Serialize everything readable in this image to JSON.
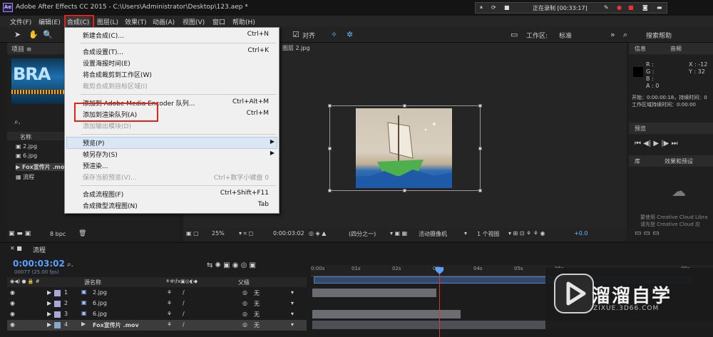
{
  "window": {
    "app_icon": "Ae",
    "title": "Adobe After Effects CC 2015 - C:\\Users\\Administrator\\Desktop\\123.aep *",
    "recording": "正在录制 [00:33:17]"
  },
  "menubar": [
    "文件(F)",
    "编辑(E)",
    "合成(C)",
    "图层(L)",
    "效果(T)",
    "动画(A)",
    "视图(V)",
    "窗口",
    "帮助(H)"
  ],
  "toolbar": {
    "snap_label": "对齐",
    "workspace_label": "工作区:",
    "workspace_value": "标准",
    "search_help": "搜索帮助"
  },
  "composition_menu": {
    "items": [
      {
        "label": "新建合成(C)...",
        "shortcut": "Ctrl+N",
        "disabled": false
      },
      {
        "label": "合成设置(T)...",
        "shortcut": "Ctrl+K",
        "disabled": false
      },
      {
        "label": "设置海报时间(E)",
        "shortcut": "",
        "disabled": false
      },
      {
        "label": "将合成裁剪到工作区(W)",
        "shortcut": "",
        "disabled": false
      },
      {
        "label": "裁剪合成到目标区域(I)",
        "shortcut": "",
        "disabled": true
      },
      {
        "label": "添加到 Adobe Media Encoder 队列...",
        "shortcut": "Ctrl+Alt+M",
        "disabled": false
      },
      {
        "label": "添加到渲染队列(A)",
        "shortcut": "Ctrl+M",
        "disabled": false
      },
      {
        "label": "添加输出模块(D)",
        "shortcut": "",
        "disabled": true
      },
      {
        "label": "预览(P)",
        "shortcut": "",
        "disabled": false,
        "submenu": true
      },
      {
        "label": "帧另存为(S)",
        "shortcut": "",
        "disabled": false,
        "submenu": true
      },
      {
        "label": "预渲染...",
        "shortcut": "",
        "disabled": false
      },
      {
        "label": "保存当前预览(V)...",
        "shortcut": "Ctrl+数字小键盘 0",
        "disabled": true
      },
      {
        "label": "合成流程图(F)",
        "shortcut": "Ctrl+Shift+F11",
        "disabled": false
      },
      {
        "label": "合成微型流程图(N)",
        "shortcut": "Tab",
        "disabled": false
      }
    ]
  },
  "project_panel": {
    "title": "项目",
    "thumb_text": "BRA",
    "column_name": "名称",
    "files": [
      "2.jpg",
      "6.jpg",
      "Fox宣传片 .mov",
      "流程"
    ],
    "bit_depth": "8 bpc"
  },
  "composition": {
    "layer_tab": "图层 2.jpg",
    "zoom": "25%",
    "timecode": "0:00:03:02",
    "resolution": "(四分之一)",
    "camera": "活动摄像机",
    "views": "1 个视图",
    "exposure": "+0.0"
  },
  "info_panel": {
    "tabs": [
      "信息",
      "音频"
    ],
    "channels": [
      "R :",
      "G :",
      "B :",
      "A : 0"
    ],
    "coords": [
      "X : -12",
      "Y : 32"
    ],
    "start": "开始：0:00:00:18，持续时间：0",
    "work_area": "工作区域持续时间：0:00:00"
  },
  "preview_panel": {
    "title": "预览"
  },
  "library_panel": {
    "tabs": [
      "库",
      "效果和预设"
    ],
    "cc_msg1": "要使用 Creative Cloud Libra",
    "cc_msg2": "请先登 Creative Cloud 应"
  },
  "timeline": {
    "comp_name": "流程",
    "time": "0:00:03:02",
    "fps": "00077 (25.00 fps)",
    "col_source": "源名称",
    "col_parent": "父级",
    "ruler": [
      "0:00s",
      "01s",
      "02s",
      "03s",
      "04s",
      "05s",
      "06s",
      "09s"
    ],
    "layers": [
      {
        "num": "1",
        "name": "2.jpg",
        "parent": "无",
        "color": "#a9a6d8"
      },
      {
        "num": "2",
        "name": "6.jpg",
        "parent": "无",
        "color": "#a9a6d8"
      },
      {
        "num": "3",
        "name": "6.jpg",
        "parent": "无",
        "color": "#a9a6d8"
      },
      {
        "num": "4",
        "name": "Fox宣传片 .mov",
        "parent": "无",
        "color": "#88a7c9"
      }
    ]
  },
  "watermark": {
    "brand": "溜溜自学",
    "url": "ZIXUE.3D66.COM"
  }
}
